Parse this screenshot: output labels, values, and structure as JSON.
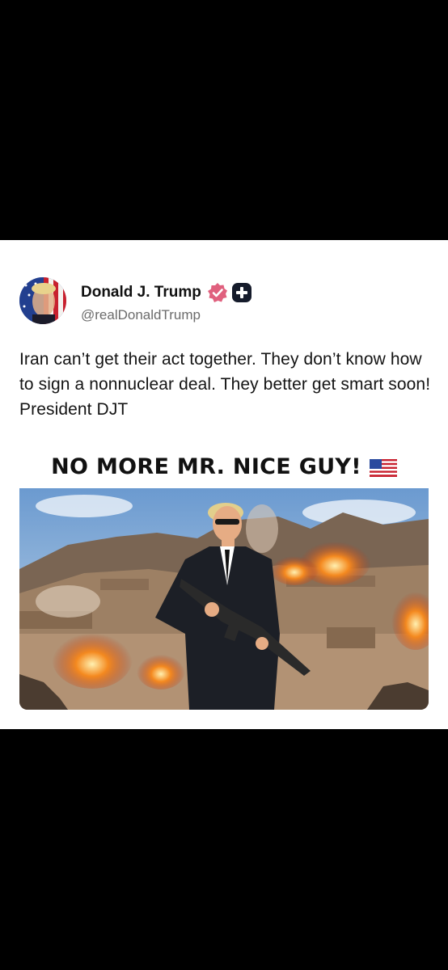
{
  "post": {
    "author": {
      "display_name": "Donald J. Trump",
      "handle": "@realDonaldTrump",
      "verified_icon": "verified-badge-icon",
      "extra_icon": "plus-badge-icon"
    },
    "text": "Iran can’t get their act together. They don’t know how to sign a nonnuclear deal. They better get smart soon! President DJT",
    "image": {
      "caption": "NO MORE MR. NICE GUY!",
      "caption_icon": "us-flag-icon"
    }
  },
  "colors": {
    "page_background": "#000000",
    "card_background": "#ffffff",
    "verified_badge": "#e0607e",
    "handle_text": "#6b6b6b"
  }
}
